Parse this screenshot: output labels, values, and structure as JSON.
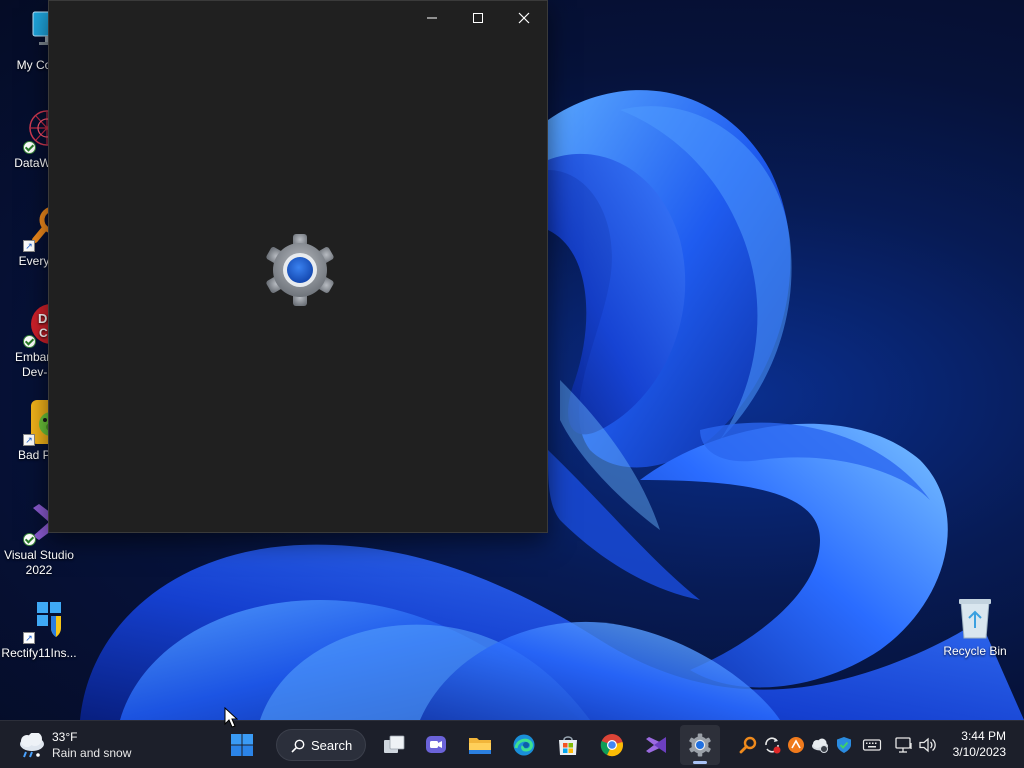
{
  "desktop": {
    "icons": [
      {
        "label": "My Com",
        "icon": "monitor-icon",
        "badge": "none"
      },
      {
        "label": "DataWag",
        "icon": "datawagon-icon",
        "badge": "check"
      },
      {
        "label": "Everyth",
        "icon": "everything-search-icon",
        "badge": "shortcut"
      },
      {
        "label": "Embarca",
        "label2": "Dev-C",
        "icon": "devcpp-icon",
        "badge": "check"
      },
      {
        "label": "Bad Pig",
        "icon": "bad-piggies-icon",
        "badge": "shortcut"
      },
      {
        "label": "Visual Studio",
        "label2": "2022",
        "icon": "visual-studio-icon",
        "badge": "check"
      },
      {
        "label": "Rectify11Ins...",
        "icon": "rectify11-installer-icon",
        "badge": "shortcut"
      }
    ],
    "recycle_bin": {
      "label": "Recycle Bin",
      "icon": "recycle-bin-icon"
    }
  },
  "window": {
    "app": "Settings",
    "state": "loading",
    "splash_icon": "settings-gear-icon",
    "controls": {
      "minimize": "minimize-icon",
      "maximize": "maximize-icon",
      "close": "close-icon"
    }
  },
  "taskbar": {
    "weather": {
      "temp": "33°F",
      "condition": "Rain and snow",
      "icon": "rain-snow-cloud-icon"
    },
    "search": {
      "label": "Search",
      "icon": "search-icon"
    },
    "pinned": [
      {
        "name": "start",
        "icon": "windows-logo-icon"
      },
      {
        "name": "task-view",
        "icon": "task-view-icon"
      },
      {
        "name": "teams-chat",
        "icon": "teams-chat-icon"
      },
      {
        "name": "file-explorer",
        "icon": "folder-icon"
      },
      {
        "name": "edge",
        "icon": "edge-icon"
      },
      {
        "name": "microsoft-store",
        "icon": "store-icon"
      },
      {
        "name": "chrome",
        "icon": "chrome-icon"
      },
      {
        "name": "visual-studio",
        "icon": "visual-studio-icon"
      },
      {
        "name": "settings",
        "icon": "settings-gear-icon",
        "active": true
      }
    ],
    "tray": [
      "everything-tray-icon",
      "sync-icon",
      "orange-app-icon",
      "onedrive-icon",
      "defender-shield-icon",
      "keyboard-icon",
      "network-icon",
      "volume-icon"
    ],
    "clock": {
      "time": "3:44 PM",
      "date": "3/10/2023"
    }
  },
  "colors": {
    "window_bg": "#202020",
    "taskbar_bg": "#1c1f2a",
    "accent": "#1f6fe0",
    "wallpaper_deep": "#06123a"
  }
}
